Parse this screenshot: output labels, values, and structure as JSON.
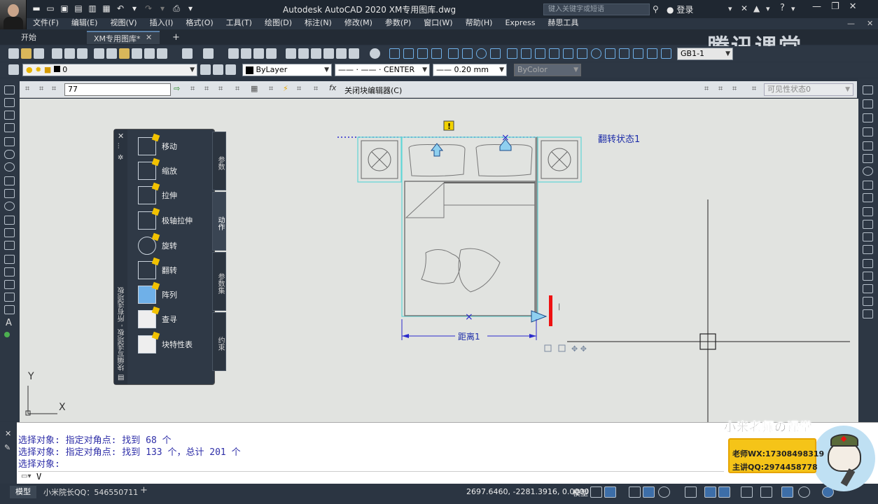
{
  "title_bar": {
    "app_title": "Autodesk AutoCAD 2020    XM专用图库.dwg",
    "search_placeholder": "键入关键字或短语",
    "login_label": "登录"
  },
  "menu": [
    "文件(F)",
    "编辑(E)",
    "视图(V)",
    "插入(I)",
    "格式(O)",
    "工具(T)",
    "绘图(D)",
    "标注(N)",
    "修改(M)",
    "参数(P)",
    "窗口(W)",
    "帮助(H)",
    "Express",
    "赫思工具"
  ],
  "tabs": {
    "start": "开始",
    "document": "XM专用图库*",
    "add": "+"
  },
  "watermark": "腾讯课堂",
  "toolbar": {
    "layer_value": "0",
    "color_value": "ByLayer",
    "linetype_value": "—— · —— · CENTER",
    "lineweight_value": "—— 0.20 mm",
    "plotstyle_value": "ByColor",
    "dimstyle_value": "GB1-1"
  },
  "block_editor": {
    "block_name": "77",
    "close_label": "关闭块编辑器(C)",
    "visibility_state": "可见性状态0"
  },
  "palette": {
    "title": "块编写选项板 - 所有选项板",
    "items": [
      "移动",
      "缩放",
      "拉伸",
      "极轴拉伸",
      "旋转",
      "翻转",
      "阵列",
      "查寻",
      "块特性表"
    ],
    "side_tabs": [
      "参数",
      "动作",
      "参数集",
      "约束"
    ]
  },
  "drawing": {
    "flip_label": "翻转状态1",
    "distance_label": "距离1",
    "ucs_x": "X",
    "ucs_y": "Y"
  },
  "command": {
    "lines": [
      "选择对象: 指定对角点: 找到 68 个",
      "选择对象: 指定对角点: 找到 133 个，总计 201 个",
      "选择对象:"
    ],
    "input": "V"
  },
  "status_bar": {
    "model_tab": "模型",
    "layout_tab": "小米院长QQ：546550711",
    "add_layout": "+",
    "coords": "2697.6460, -2281.3916, 0.0000",
    "model_label": "模型"
  },
  "teacher_ad": {
    "title": "小米老师の课堂",
    "wx": "老师WX:17308498319",
    "qq": "主讲QQ:2974458778"
  }
}
